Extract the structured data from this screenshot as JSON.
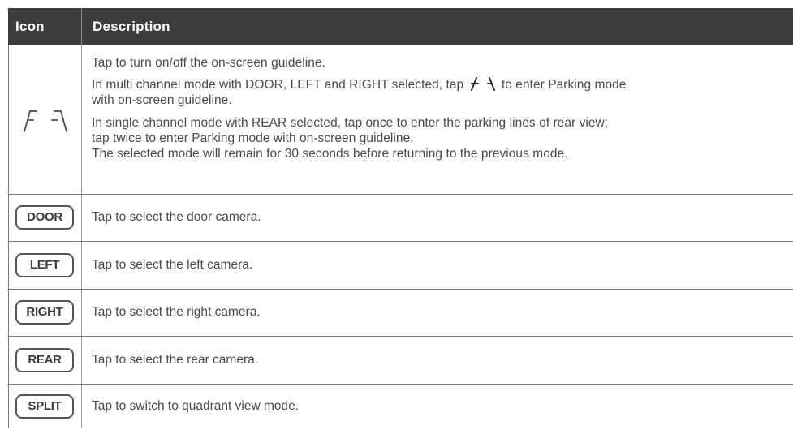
{
  "table": {
    "header": {
      "icon": "Icon",
      "description": "Description"
    },
    "guideline_row": {
      "icon": "guideline-icon",
      "lines": {
        "line1": "Tap to turn on/off the on-screen guideline.",
        "line2a": "In multi channel mode with DOOR, LEFT and RIGHT selected, tap",
        "line2b": "to enter Parking mode",
        "line2c": "with on-screen guideline.",
        "line3a": "In single channel mode with REAR selected, tap once to enter the parking lines of rear view;",
        "line3b": "tap twice to enter Parking mode with on-screen guideline.",
        "line3c": "The selected mode will remain for 30 seconds before returning to the previous mode."
      }
    },
    "rows": [
      {
        "button": "DOOR",
        "description": "Tap to select the door camera."
      },
      {
        "button": "LEFT",
        "description": "Tap to select the left camera."
      },
      {
        "button": "RIGHT",
        "description": "Tap to select the right camera."
      },
      {
        "button": "REAR",
        "description": "Tap to select the rear camera."
      },
      {
        "button": "SPLIT",
        "description": "Tap to switch to quadrant view mode."
      }
    ]
  },
  "colors": {
    "header_bg": "#3d3d3d",
    "text": "#4a4a4a",
    "button_border": "#555555"
  }
}
